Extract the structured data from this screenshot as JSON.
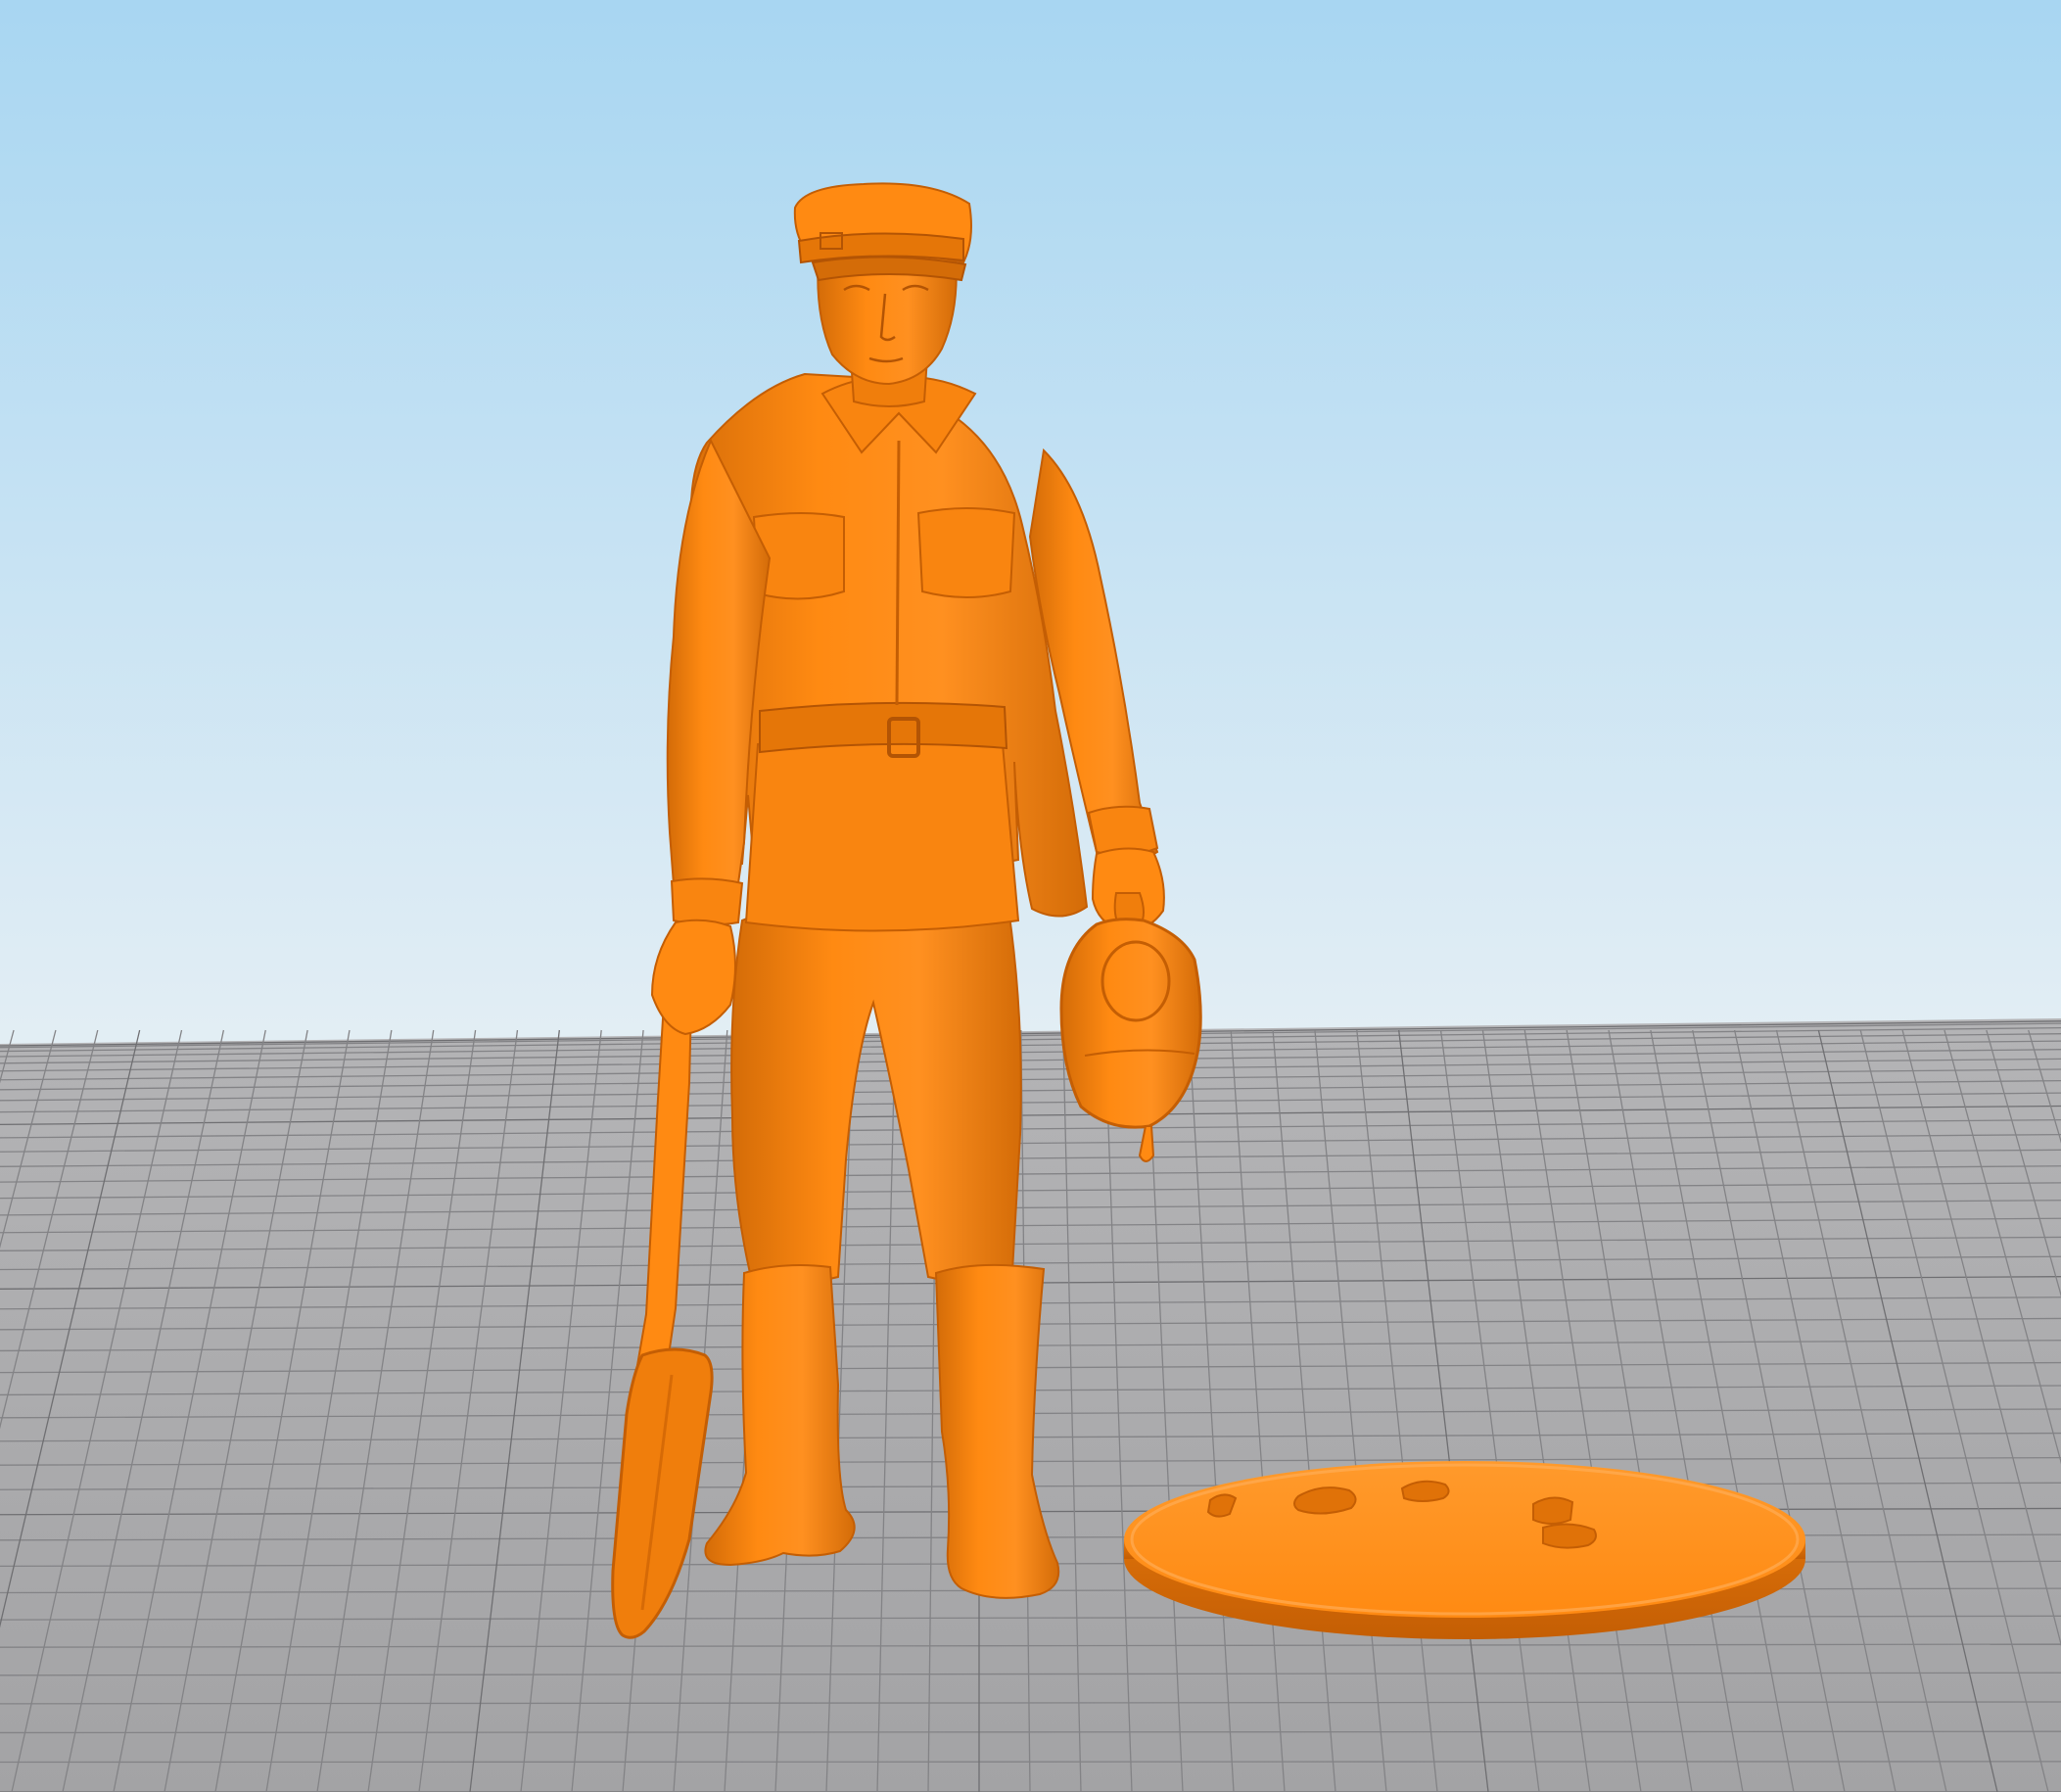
{
  "viewport": {
    "sky_top_color": "#a8d6f2",
    "sky_bottom_color": "#e3eef4",
    "floor_color": "#a3a3a5",
    "floor_far_color": "#b4b4b6",
    "grid_line_color": "#838386",
    "grid_major_color": "#6f6f72",
    "model_color": "#ff8a12",
    "model_shadow_color": "#c45e04",
    "model_highlight_color": "#ffb35c",
    "objects": [
      {
        "name": "soldier-figure",
        "icon": "standing-soldier-with-shovel-and-canteen"
      },
      {
        "name": "round-base",
        "icon": "oval-base-with-footprint-recesses"
      }
    ]
  }
}
